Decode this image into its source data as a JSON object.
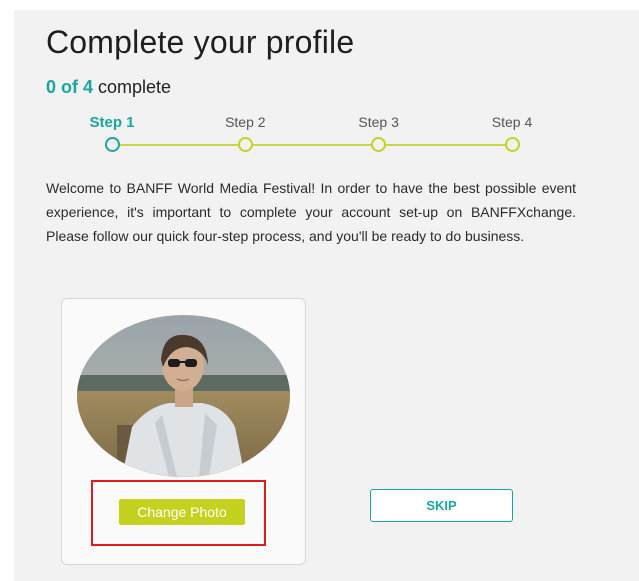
{
  "page": {
    "title": "Complete your profile",
    "progress_count": "0 of 4",
    "progress_suffix": "complete",
    "intro": "Welcome to BANFF World Media Festival! In order to have the best possible event experience, it's important to complete your account set-up on BANFFXchange. Please follow our quick four-step process, and you'll be ready to do business."
  },
  "steps": [
    {
      "label": "Step 1",
      "active": true
    },
    {
      "label": "Step 2",
      "active": false
    },
    {
      "label": "Step 3",
      "active": false
    },
    {
      "label": "Step 4",
      "active": false
    }
  ],
  "photo_card": {
    "change_photo_label": "Change Photo"
  },
  "actions": {
    "skip_label": "SKIP"
  },
  "colors": {
    "teal": "#1aa6a0",
    "lime": "#c4d21f",
    "highlight_red": "#e01b1b"
  },
  "icons": {
    "profile_photo": "profile-photo"
  }
}
